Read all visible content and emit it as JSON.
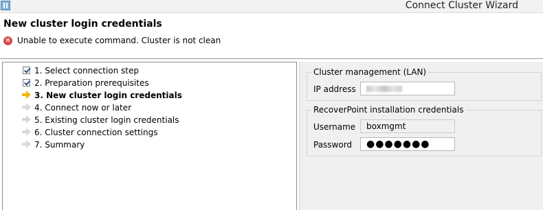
{
  "window": {
    "title": "Connect Cluster Wizard"
  },
  "header": {
    "title": "New cluster login credentials",
    "error_message": "Unable to execute command. Cluster is not clean"
  },
  "steps": [
    {
      "label": "1. Select connection step",
      "state": "done"
    },
    {
      "label": "2. Preparation prerequisites",
      "state": "done"
    },
    {
      "label": "3. New cluster login credentials",
      "state": "current"
    },
    {
      "label": "4. Connect now or later",
      "state": "pending"
    },
    {
      "label": "5. Existing cluster login credentials",
      "state": "pending"
    },
    {
      "label": "6. Cluster connection settings",
      "state": "pending"
    },
    {
      "label": "7. Summary",
      "state": "pending"
    }
  ],
  "cluster_management": {
    "title": "Cluster management (LAN)",
    "ip_label": "IP address",
    "ip_value": ""
  },
  "credentials": {
    "title": "RecoverPoint installation credentials",
    "username_label": "Username",
    "username_value": "boxmgmt",
    "password_label": "Password",
    "password_mask": "●●●●●●●"
  },
  "colors": {
    "error": "#d84a4a",
    "current_arrow": "#f2b400",
    "pending_arrow": "#d8d8d8",
    "panel_bg": "#f0f0f0"
  }
}
